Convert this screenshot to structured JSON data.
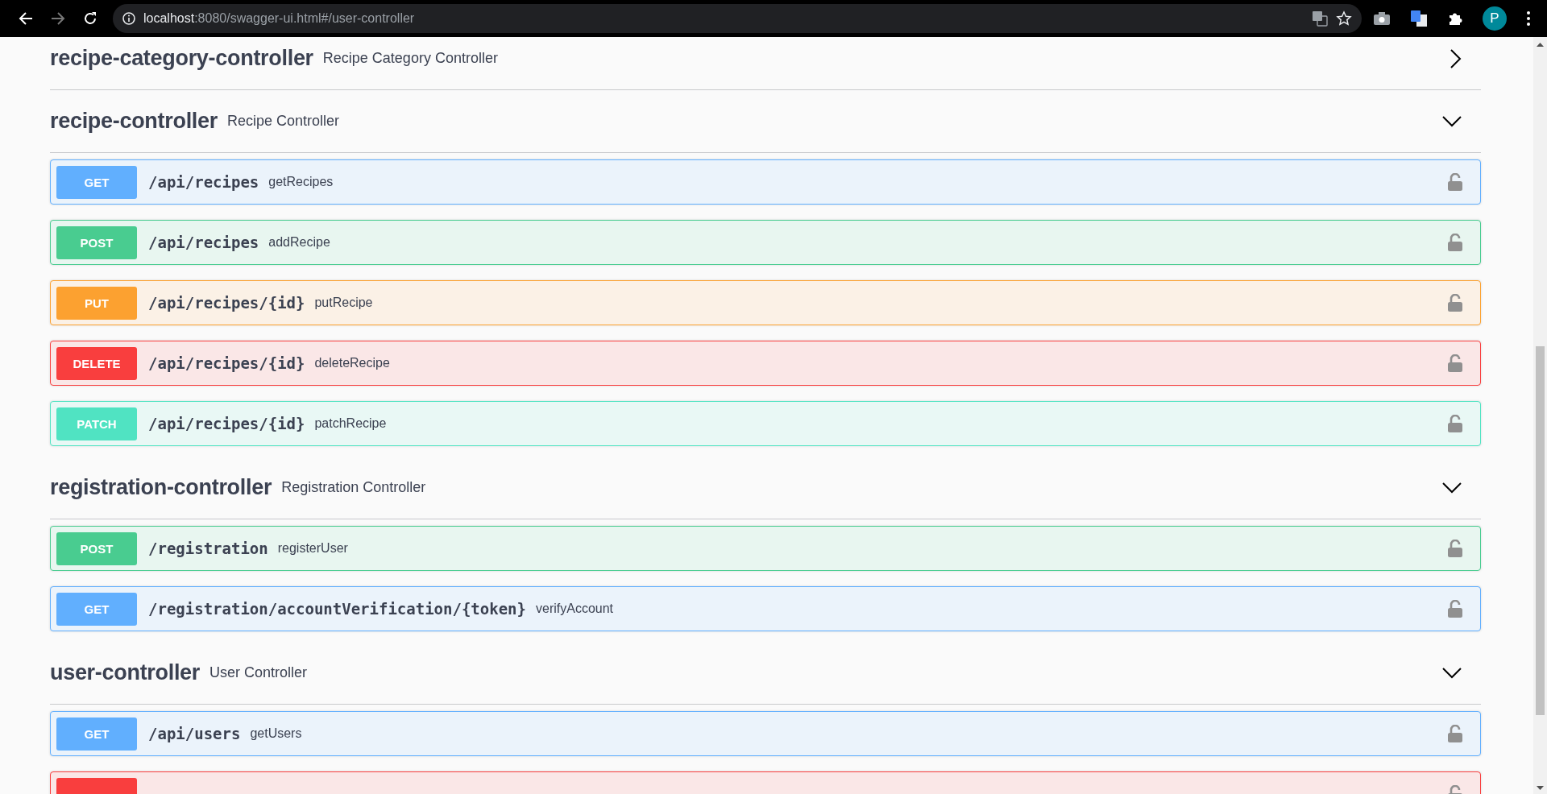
{
  "browser": {
    "url_host": "localhost",
    "url_rest": ":8080/swagger-ui.html#/user-controller",
    "profile_initial": "P"
  },
  "sections": [
    {
      "name": "recipe-category-controller",
      "description": "Recipe Category Controller",
      "expanded": false
    },
    {
      "name": "recipe-controller",
      "description": "Recipe Controller",
      "expanded": true,
      "operations": [
        {
          "kind": "get",
          "method": "GET",
          "path": "/api/recipes",
          "summary": "getRecipes"
        },
        {
          "kind": "post",
          "method": "POST",
          "path": "/api/recipes",
          "summary": "addRecipe"
        },
        {
          "kind": "put",
          "method": "PUT",
          "path": "/api/recipes/{id}",
          "summary": "putRecipe"
        },
        {
          "kind": "delete",
          "method": "DELETE",
          "path": "/api/recipes/{id}",
          "summary": "deleteRecipe"
        },
        {
          "kind": "patch",
          "method": "PATCH",
          "path": "/api/recipes/{id}",
          "summary": "patchRecipe"
        }
      ]
    },
    {
      "name": "registration-controller",
      "description": "Registration Controller",
      "expanded": true,
      "operations": [
        {
          "kind": "post",
          "method": "POST",
          "path": "/registration",
          "summary": "registerUser"
        },
        {
          "kind": "get",
          "method": "GET",
          "path": "/registration/accountVerification/{token}",
          "summary": "verifyAccount"
        }
      ]
    },
    {
      "name": "user-controller",
      "description": "User Controller",
      "expanded": true,
      "operations": [
        {
          "kind": "get",
          "method": "GET",
          "path": "/api/users",
          "summary": "getUsers"
        },
        {
          "kind": "delete"
        }
      ]
    }
  ]
}
